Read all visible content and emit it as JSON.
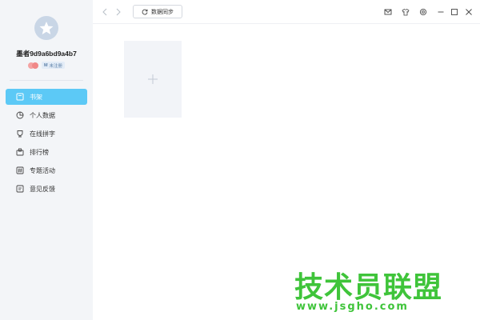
{
  "profile": {
    "username": "墨者9d9a6bd9a4b7",
    "status_tag": "未注册"
  },
  "sidebar": {
    "items": [
      {
        "label": "书架",
        "icon": "bookshelf-icon",
        "active": true
      },
      {
        "label": "个人数据",
        "icon": "clock-chart-icon",
        "active": false
      },
      {
        "label": "在线拼字",
        "icon": "trophy-icon",
        "active": false
      },
      {
        "label": "排行榜",
        "icon": "ranking-icon",
        "active": false
      },
      {
        "label": "专题活动",
        "icon": "hashtag-icon",
        "active": false
      },
      {
        "label": "意见反馈",
        "icon": "feedback-icon",
        "active": false
      }
    ]
  },
  "toolbar": {
    "sync_label": "数据同步"
  },
  "watermark": {
    "title": "技术员联盟",
    "url": "www.jsgho.com"
  },
  "colors": {
    "accent": "#5cc9f6",
    "sidebar_bg": "#f3f5f8",
    "watermark": "#3fc43a"
  }
}
